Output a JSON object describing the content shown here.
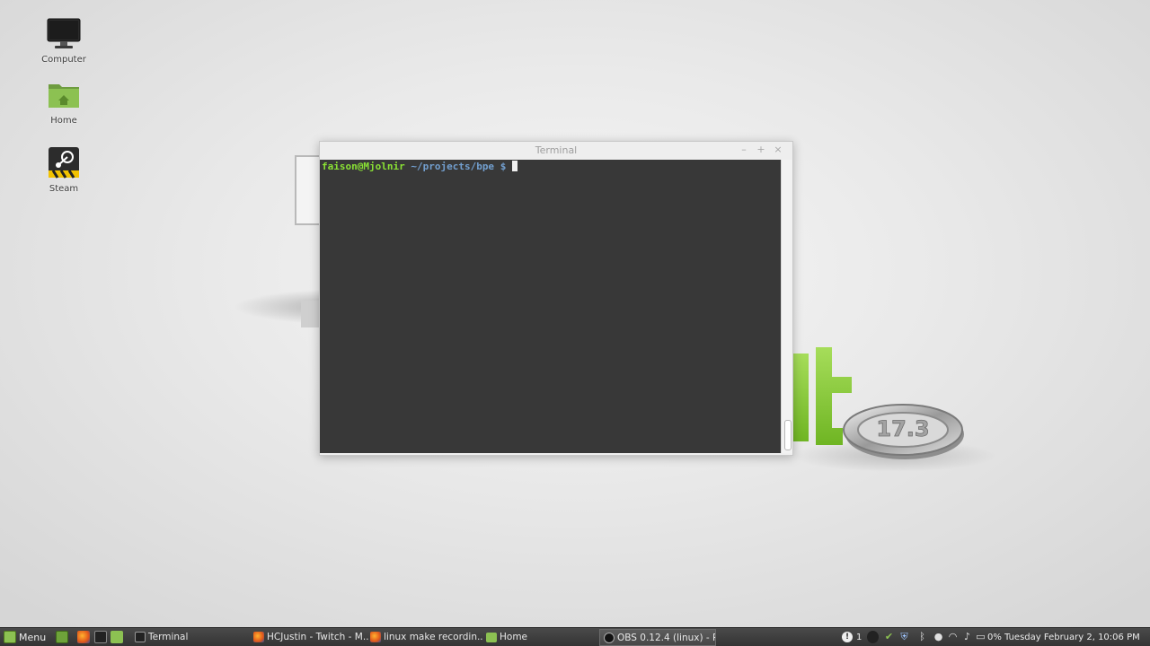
{
  "desktop": {
    "icons": [
      {
        "label": "Computer",
        "icon": "computer-icon"
      },
      {
        "label": "Home",
        "icon": "home-folder-icon"
      },
      {
        "label": "Steam",
        "icon": "steam-icon"
      }
    ],
    "wallpaper_badge": "17.3"
  },
  "terminal": {
    "title": "Terminal",
    "controls": {
      "minimize": "–",
      "maximize": "+",
      "close": "×"
    },
    "prompt": {
      "user_host": "faison@Mjolnir",
      "path": "~/projects/bpe",
      "symbol": "$"
    },
    "colors": {
      "background": "#383838",
      "user": "#8ae234",
      "path": "#729fcf"
    }
  },
  "taskbar": {
    "menu_label": "Menu",
    "launchers": [
      "show-desktop-icon",
      "firefox-icon",
      "terminal-icon",
      "files-icon"
    ],
    "tasks": [
      {
        "label": "Terminal",
        "icon": "terminal-icon",
        "active": false
      },
      {
        "label": "HCJustin - Twitch - M...",
        "icon": "firefox-icon",
        "active": false
      },
      {
        "label": "linux make recordin...",
        "icon": "firefox-icon",
        "active": false
      },
      {
        "label": "Home",
        "icon": "folder-icon",
        "active": false
      },
      {
        "label": "OBS 0.12.4 (linux) - P...",
        "icon": "obs-icon",
        "active": true
      }
    ],
    "tray": {
      "notification_count": "1",
      "battery": "0%",
      "clock": "Tuesday February  2, 10:06 PM"
    }
  }
}
